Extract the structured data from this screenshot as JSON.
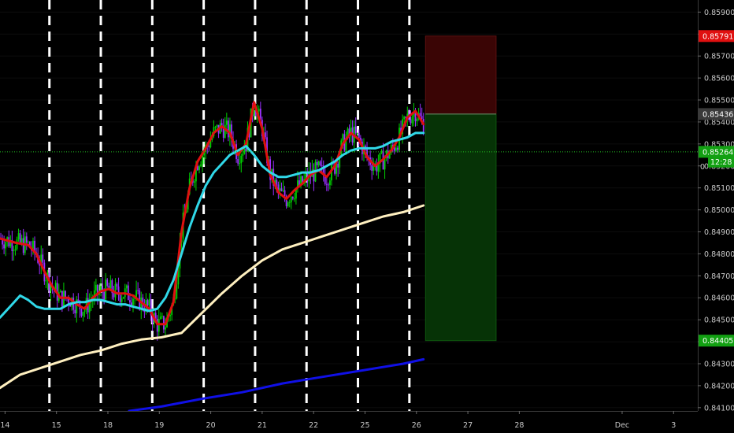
{
  "chart_data": {
    "type": "candlestick",
    "y_axis": {
      "ticks": [
        "0.85900",
        "0.85800",
        "0.85700",
        "0.85600",
        "0.85500",
        "0.85400",
        "0.85300",
        "0.85200",
        "0.85100",
        "0.85000",
        "0.84900",
        "0.84800",
        "0.84700",
        "0.84600",
        "0.84500",
        "0.84400",
        "0.84300",
        "0.84200",
        "0.84100"
      ],
      "tick_values": [
        0.859,
        0.858,
        0.857,
        0.856,
        0.855,
        0.854,
        0.853,
        0.852,
        0.851,
        0.85,
        0.849,
        0.848,
        0.847,
        0.846,
        0.845,
        0.844,
        0.843,
        0.842,
        0.841
      ],
      "ylim": [
        0.84085,
        0.85955
      ]
    },
    "x_axis": {
      "ticks": [
        "14",
        "15",
        "18",
        "19",
        "20",
        "21",
        "22",
        "25",
        "26",
        "27",
        "28",
        "Dec",
        "3"
      ],
      "tick_positions": [
        2.5,
        28,
        53.5,
        79,
        104.5,
        130,
        155.5,
        181,
        206.5,
        232,
        257.5,
        308.5,
        334
      ],
      "xlim": [
        0,
        346
      ]
    },
    "price_tags": [
      {
        "value": 0.85791,
        "label": "0.85791",
        "color": "#e01010"
      },
      {
        "value": 0.85436,
        "label": "0.85436",
        "color": "#3a3a3a"
      },
      {
        "value": 0.85264,
        "label": "0.85264",
        "color": "#12a012"
      },
      {
        "value": 0.84405,
        "label": "0.84405",
        "color": "#12a012"
      }
    ],
    "countdown": {
      "value": 0.85218,
      "label": "12:28",
      "color": "#12a012"
    },
    "extra_axis_label": "0",
    "current_price": 0.85264,
    "position": {
      "x_start": 211,
      "x_end": 246,
      "entry": 0.85436,
      "stop": 0.85791,
      "target": 0.84405
    },
    "session_lines_x": [
      24.5,
      50,
      75.5,
      101,
      126.5,
      152,
      177.5,
      203
    ],
    "ma_series": [
      {
        "color": "#e01010",
        "x": [
          0,
          8,
          14,
          18,
          22,
          26,
          30,
          34,
          38,
          42,
          46,
          50,
          54,
          58,
          62,
          66,
          70,
          74,
          78,
          82,
          86,
          90,
          94,
          98,
          102,
          106,
          110,
          114,
          118,
          122,
          126,
          130,
          134,
          138,
          142,
          146,
          150,
          154,
          158,
          162,
          166,
          170,
          174,
          178,
          182,
          186,
          190,
          194,
          198,
          202,
          206,
          210
        ],
        "y": [
          0.8487,
          0.8485,
          0.8484,
          0.848,
          0.8472,
          0.8465,
          0.846,
          0.846,
          0.8457,
          0.8455,
          0.846,
          0.8463,
          0.8464,
          0.8462,
          0.8462,
          0.8461,
          0.8458,
          0.8455,
          0.8448,
          0.8448,
          0.8458,
          0.849,
          0.851,
          0.8522,
          0.8528,
          0.8535,
          0.8538,
          0.8535,
          0.8525,
          0.853,
          0.8549,
          0.8537,
          0.8516,
          0.8508,
          0.8505,
          0.8509,
          0.8512,
          0.8516,
          0.8518,
          0.8515,
          0.852,
          0.853,
          0.8535,
          0.8532,
          0.8524,
          0.852,
          0.8523,
          0.8527,
          0.8533,
          0.8542,
          0.8545,
          0.8539
        ]
      },
      {
        "color": "#30d8e8",
        "x": [
          0,
          6,
          10,
          14,
          18,
          22,
          26,
          30,
          34,
          38,
          42,
          46,
          50,
          54,
          58,
          62,
          66,
          70,
          74,
          78,
          82,
          86,
          90,
          94,
          98,
          102,
          106,
          110,
          114,
          118,
          122,
          126,
          130,
          134,
          138,
          142,
          146,
          150,
          154,
          158,
          162,
          166,
          170,
          174,
          178,
          182,
          186,
          190,
          194,
          198,
          202,
          206,
          210
        ],
        "y": [
          0.8451,
          0.8457,
          0.8461,
          0.8459,
          0.8456,
          0.8455,
          0.8455,
          0.8455,
          0.8457,
          0.8458,
          0.8458,
          0.8459,
          0.8459,
          0.8458,
          0.8457,
          0.8457,
          0.8456,
          0.8455,
          0.8454,
          0.8455,
          0.846,
          0.8468,
          0.848,
          0.8492,
          0.8502,
          0.8511,
          0.8517,
          0.8521,
          0.8525,
          0.8527,
          0.8529,
          0.8525,
          0.852,
          0.8517,
          0.8515,
          0.8515,
          0.8516,
          0.8517,
          0.8517,
          0.8518,
          0.852,
          0.8522,
          0.8525,
          0.8527,
          0.8528,
          0.8528,
          0.8528,
          0.8529,
          0.8531,
          0.8532,
          0.8533,
          0.8535,
          0.8535
        ]
      },
      {
        "color": "#fff0c0",
        "x": [
          0,
          10,
          20,
          30,
          40,
          50,
          60,
          70,
          80,
          90,
          100,
          110,
          120,
          130,
          140,
          150,
          160,
          170,
          180,
          190,
          200,
          210
        ],
        "y": [
          0.8419,
          0.8425,
          0.8428,
          0.8431,
          0.8434,
          0.8436,
          0.8439,
          0.8441,
          0.8442,
          0.8444,
          0.8453,
          0.8462,
          0.847,
          0.8477,
          0.8482,
          0.8485,
          0.8488,
          0.8491,
          0.8494,
          0.8497,
          0.8499,
          0.8502
        ]
      },
      {
        "color": "#1010e6",
        "x": [
          64,
          80,
          100,
          120,
          140,
          160,
          180,
          200,
          210
        ],
        "y": [
          0.84085,
          0.84105,
          0.8414,
          0.8417,
          0.8421,
          0.8424,
          0.8427,
          0.843,
          0.8432
        ]
      }
    ]
  }
}
